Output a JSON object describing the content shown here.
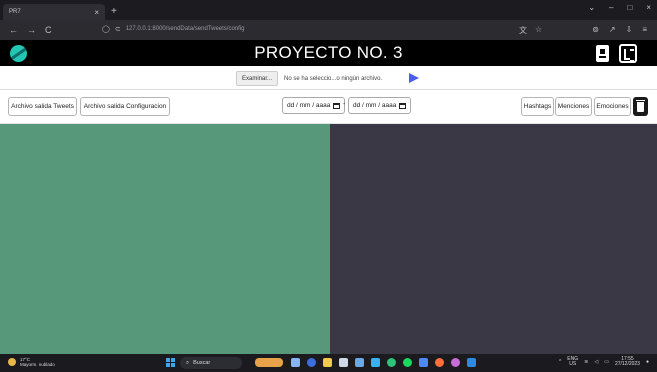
{
  "browser": {
    "tab_title": "PR7",
    "tab_close": "×",
    "new_tab": "+",
    "url": "127.0.0.1:8000/sendData/sendTweets/config",
    "nav": {
      "back": "←",
      "forward": "→",
      "reload": "C"
    },
    "window_controls": {
      "chevron": "⌄",
      "minimize": "–",
      "maximize": "□",
      "close": "×"
    }
  },
  "app": {
    "title": "PROYECTO NO. 3",
    "colors": {
      "header_bg": "#000000",
      "left_pane": "#58987a",
      "right_pane": "#393844",
      "accent": "#4a5cf0"
    }
  },
  "upload": {
    "browse_label": "Examinar...",
    "file_status": "No se ha seleccio...o ningún archivo."
  },
  "toolbar": {
    "tweets_output": "Archivo salida Tweets",
    "config_output": "Archivo salida Configuracion",
    "date_from": "dd / mm / aaaa",
    "date_to": "dd / mm / aaaa",
    "date_separator": "-",
    "hashtags": "Hashtags",
    "menciones": "Menciones",
    "emociones": "Emociones"
  },
  "taskbar": {
    "weather_temp": "17°C",
    "weather_desc": "Mayorm. nublado",
    "search_label": "Buscar",
    "lang_top": "ENG",
    "lang_bottom": "US",
    "time": "17:55",
    "date": "27/12/2023"
  }
}
